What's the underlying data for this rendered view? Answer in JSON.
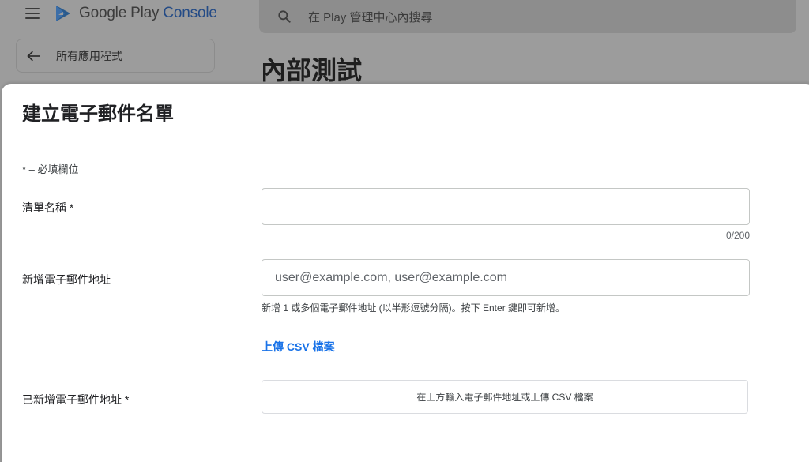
{
  "header": {
    "logo_google_play": "Google Play",
    "logo_console": "Console",
    "search_placeholder": "在 Play 管理中心內搜尋",
    "back_label": "所有應用程式",
    "page_title": "內部測試"
  },
  "dialog": {
    "title": "建立電子郵件名單",
    "required_note": "* – 必填欄位",
    "list_name": {
      "label": "清單名稱 *",
      "value": "",
      "counter": "0/200"
    },
    "add_emails": {
      "label": "新增電子郵件地址",
      "placeholder": "user@example.com, user@example.com",
      "hint": "新增 1 或多個電子郵件地址 (以半形逗號分隔)。按下 Enter 鍵即可新增。",
      "upload_csv": "上傳 CSV 檔案"
    },
    "added_emails": {
      "label": "已新增電子郵件地址 *",
      "empty_text": "在上方輸入電子郵件地址或上傳 CSV 檔案"
    }
  },
  "colors": {
    "accent": "#1a73e8",
    "overlay": "#9c9c9c",
    "dialog_bg": "#ffffff"
  },
  "icons": [
    "menu-icon",
    "google-play-logo-icon",
    "search-icon",
    "arrow-back-icon"
  ]
}
